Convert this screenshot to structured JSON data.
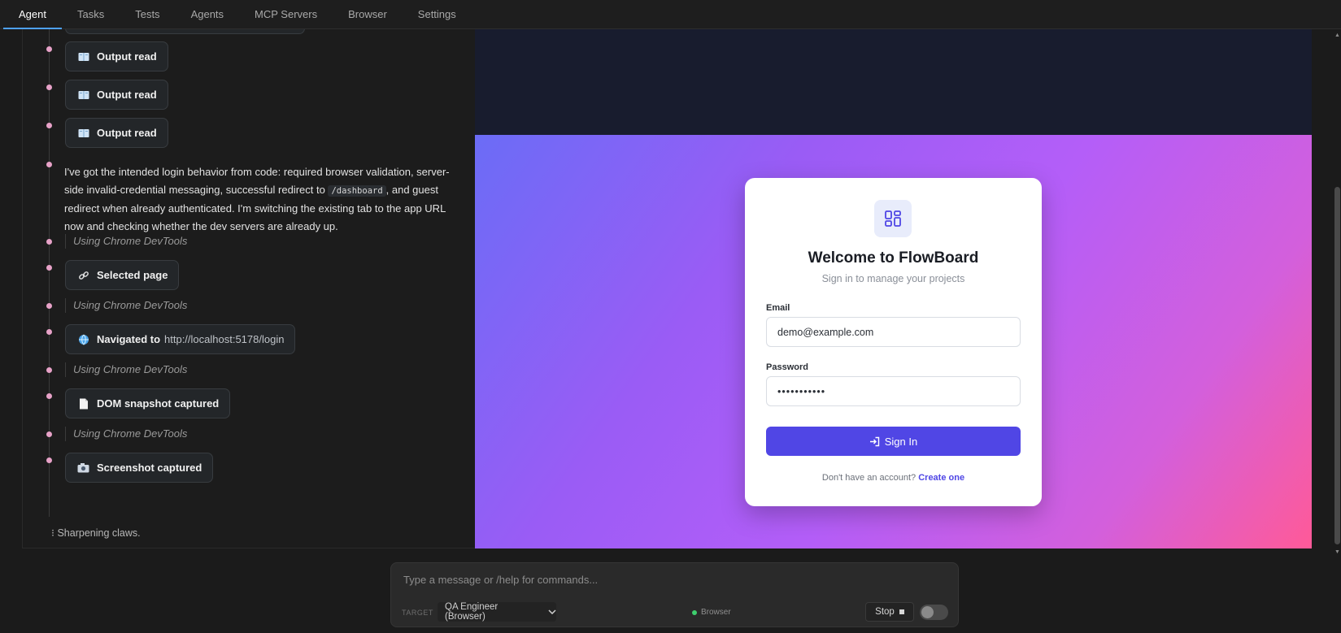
{
  "tabs": [
    {
      "label": "Agent",
      "active": true
    },
    {
      "label": "Tasks"
    },
    {
      "label": "Tests"
    },
    {
      "label": "Agents"
    },
    {
      "label": "MCP Servers"
    },
    {
      "label": "Browser"
    },
    {
      "label": "Settings"
    }
  ],
  "timeline": {
    "output_reads": [
      "Output read",
      "Output read",
      "Output read"
    ],
    "message": {
      "part1": "I've got the intended login behavior from code: required browser validation, server-side invalid-credential messaging, successful redirect to ",
      "code": "/dashboard",
      "part2": ", and guest redirect when already authenticated. I'm switching the existing tab to the app URL now and checking whether the dev servers are already up."
    },
    "using_label": "Using Chrome DevTools",
    "selected_page": "Selected page",
    "navigated_label": "Navigated to",
    "navigated_url": "http://localhost:5178/login",
    "dom_snapshot": "DOM snapshot captured",
    "screenshot": "Screenshot captured",
    "status": "Sharpening claws."
  },
  "login": {
    "title": "Welcome to FlowBoard",
    "subtitle": "Sign in to manage your projects",
    "email_label": "Email",
    "email_value": "demo@example.com",
    "password_label": "Password",
    "password_value": "•••••••••••",
    "sign_in": "Sign In",
    "no_account": "Don't have an account?",
    "create": "Create one"
  },
  "composer": {
    "placeholder": "Type a message or /help for commands...",
    "target_label": "TARGET",
    "target_value": "QA Engineer (Browser)",
    "browser_status": "Browser",
    "stop": "Stop"
  },
  "colors": {
    "accent_tab": "#4ea1ff",
    "timeline_dot": "#e7a2c8",
    "sign_in_button": "#5046e5",
    "status_green": "#3ecf6e"
  }
}
